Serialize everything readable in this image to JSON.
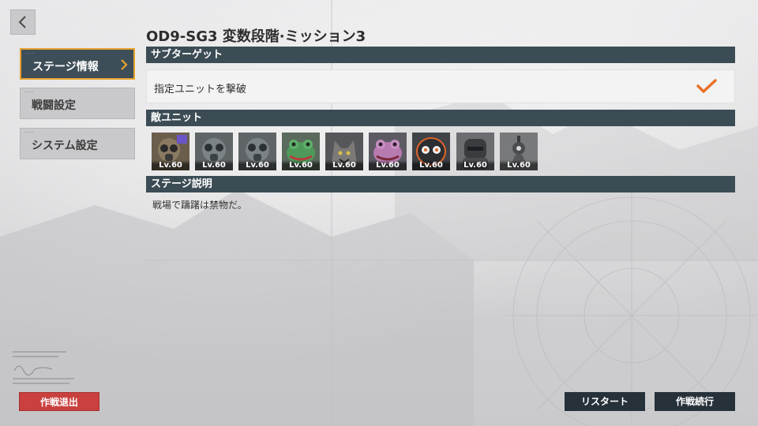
{
  "stage_title": "OD9-SG3 変数段階·ミッション3",
  "menu": {
    "items": [
      {
        "label": "ステージ情報",
        "active": true
      },
      {
        "label": "戦闘設定",
        "active": false
      },
      {
        "label": "システム設定",
        "active": false
      }
    ]
  },
  "sections": {
    "subtarget": "サブターゲット",
    "enemy_units": "敵ユニット",
    "stage_description": "ステージ説明"
  },
  "objective": {
    "text": "指定ユニットを撃破",
    "completed": true
  },
  "enemy_units": [
    {
      "level": "Lv.60",
      "icon": "gasmask-soldier-boss-portrait"
    },
    {
      "level": "Lv.60",
      "icon": "gasmask-soldier-portrait"
    },
    {
      "level": "Lv.60",
      "icon": "gasmask-soldier-portrait"
    },
    {
      "level": "Lv.60",
      "icon": "green-toad-creature-portrait"
    },
    {
      "level": "Lv.60",
      "icon": "grey-wolf-beast-portrait"
    },
    {
      "level": "Lv.60",
      "icon": "pink-toad-creature-portrait"
    },
    {
      "level": "Lv.60",
      "icon": "orange-eyed-robot-portrait"
    },
    {
      "level": "Lv.60",
      "icon": "dark-armored-robot-portrait"
    },
    {
      "level": "Lv.60",
      "icon": "sentry-turret-portrait"
    }
  ],
  "stage_description_text": "戦場で躊躇は禁物だ。",
  "buttons": {
    "retreat": "作戦退出",
    "restart": "リスタート",
    "continue": "作戦続行"
  },
  "colors": {
    "section_bar": "#3c4c55",
    "active_border": "#e7a230",
    "check": "#e8712a",
    "retreat_button": "#c9403e",
    "dark_button": "#26313a"
  }
}
